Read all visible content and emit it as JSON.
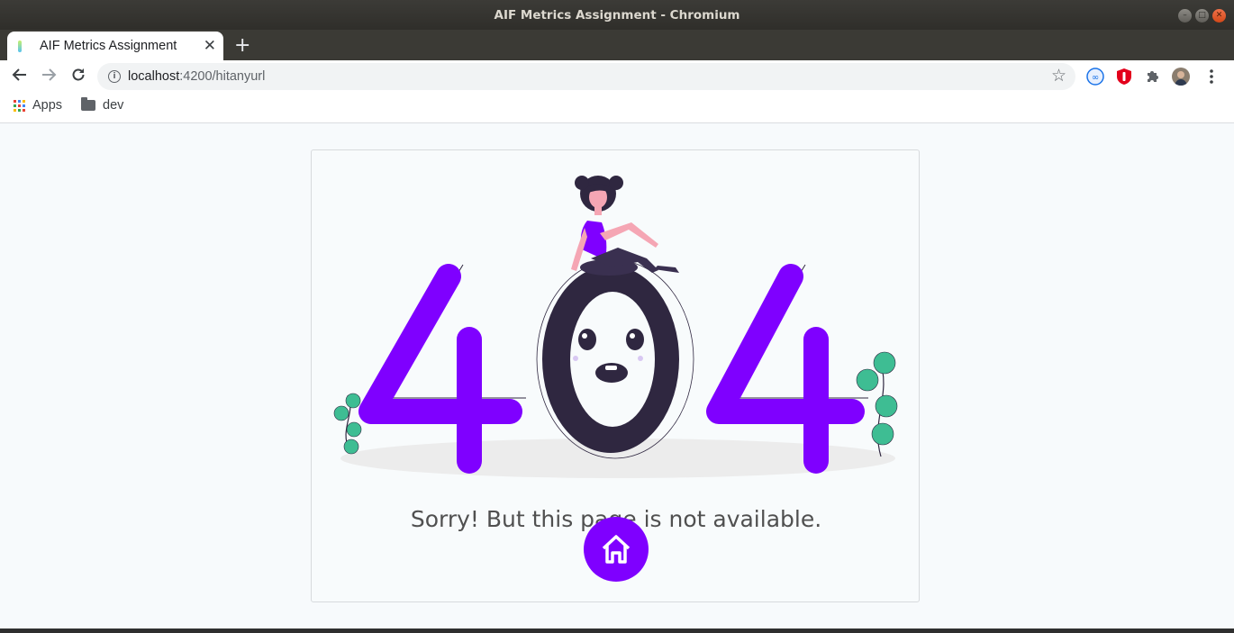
{
  "window": {
    "title": "AIF Metrics Assignment - Chromium"
  },
  "tab": {
    "title": "AIF Metrics Assignment",
    "close": "✕",
    "new_tab": "+"
  },
  "address_bar": {
    "host": "localhost",
    "rest": ":4200/hitanyurl"
  },
  "bookmarks": [
    {
      "label": "Apps",
      "icon": "apps-grid-icon"
    },
    {
      "label": "dev",
      "icon": "folder-icon"
    }
  ],
  "page": {
    "message": "Sorry! But this page is not available.",
    "big_text": [
      "4",
      "0",
      "4"
    ],
    "accent_color": "#7f00ff",
    "dark_color": "#2f2740",
    "plant_color": "#3ebd93"
  }
}
